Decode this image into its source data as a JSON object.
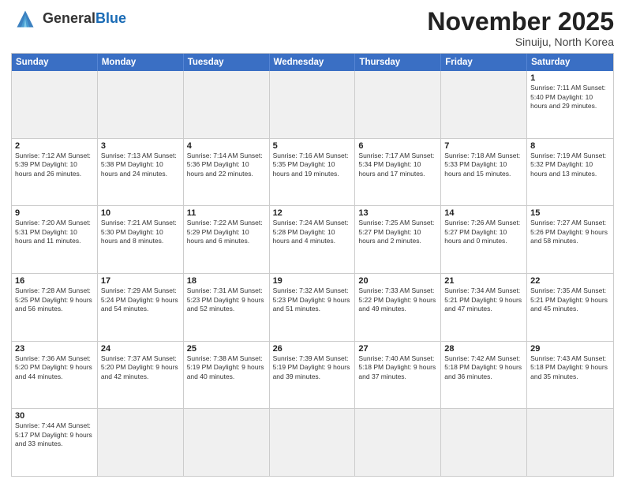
{
  "header": {
    "logo_general": "General",
    "logo_blue": "Blue",
    "month_title": "November 2025",
    "location": "Sinuiju, North Korea"
  },
  "days_of_week": [
    "Sunday",
    "Monday",
    "Tuesday",
    "Wednesday",
    "Thursday",
    "Friday",
    "Saturday"
  ],
  "weeks": [
    [
      {
        "day": "",
        "info": "",
        "empty": true
      },
      {
        "day": "",
        "info": "",
        "empty": true
      },
      {
        "day": "",
        "info": "",
        "empty": true
      },
      {
        "day": "",
        "info": "",
        "empty": true
      },
      {
        "day": "",
        "info": "",
        "empty": true
      },
      {
        "day": "",
        "info": "",
        "empty": true
      },
      {
        "day": "1",
        "info": "Sunrise: 7:11 AM\nSunset: 5:40 PM\nDaylight: 10 hours and 29 minutes.",
        "empty": false
      }
    ],
    [
      {
        "day": "2",
        "info": "Sunrise: 7:12 AM\nSunset: 5:39 PM\nDaylight: 10 hours and 26 minutes.",
        "empty": false
      },
      {
        "day": "3",
        "info": "Sunrise: 7:13 AM\nSunset: 5:38 PM\nDaylight: 10 hours and 24 minutes.",
        "empty": false
      },
      {
        "day": "4",
        "info": "Sunrise: 7:14 AM\nSunset: 5:36 PM\nDaylight: 10 hours and 22 minutes.",
        "empty": false
      },
      {
        "day": "5",
        "info": "Sunrise: 7:16 AM\nSunset: 5:35 PM\nDaylight: 10 hours and 19 minutes.",
        "empty": false
      },
      {
        "day": "6",
        "info": "Sunrise: 7:17 AM\nSunset: 5:34 PM\nDaylight: 10 hours and 17 minutes.",
        "empty": false
      },
      {
        "day": "7",
        "info": "Sunrise: 7:18 AM\nSunset: 5:33 PM\nDaylight: 10 hours and 15 minutes.",
        "empty": false
      },
      {
        "day": "8",
        "info": "Sunrise: 7:19 AM\nSunset: 5:32 PM\nDaylight: 10 hours and 13 minutes.",
        "empty": false
      }
    ],
    [
      {
        "day": "9",
        "info": "Sunrise: 7:20 AM\nSunset: 5:31 PM\nDaylight: 10 hours and 11 minutes.",
        "empty": false
      },
      {
        "day": "10",
        "info": "Sunrise: 7:21 AM\nSunset: 5:30 PM\nDaylight: 10 hours and 8 minutes.",
        "empty": false
      },
      {
        "day": "11",
        "info": "Sunrise: 7:22 AM\nSunset: 5:29 PM\nDaylight: 10 hours and 6 minutes.",
        "empty": false
      },
      {
        "day": "12",
        "info": "Sunrise: 7:24 AM\nSunset: 5:28 PM\nDaylight: 10 hours and 4 minutes.",
        "empty": false
      },
      {
        "day": "13",
        "info": "Sunrise: 7:25 AM\nSunset: 5:27 PM\nDaylight: 10 hours and 2 minutes.",
        "empty": false
      },
      {
        "day": "14",
        "info": "Sunrise: 7:26 AM\nSunset: 5:27 PM\nDaylight: 10 hours and 0 minutes.",
        "empty": false
      },
      {
        "day": "15",
        "info": "Sunrise: 7:27 AM\nSunset: 5:26 PM\nDaylight: 9 hours and 58 minutes.",
        "empty": false
      }
    ],
    [
      {
        "day": "16",
        "info": "Sunrise: 7:28 AM\nSunset: 5:25 PM\nDaylight: 9 hours and 56 minutes.",
        "empty": false
      },
      {
        "day": "17",
        "info": "Sunrise: 7:29 AM\nSunset: 5:24 PM\nDaylight: 9 hours and 54 minutes.",
        "empty": false
      },
      {
        "day": "18",
        "info": "Sunrise: 7:31 AM\nSunset: 5:23 PM\nDaylight: 9 hours and 52 minutes.",
        "empty": false
      },
      {
        "day": "19",
        "info": "Sunrise: 7:32 AM\nSunset: 5:23 PM\nDaylight: 9 hours and 51 minutes.",
        "empty": false
      },
      {
        "day": "20",
        "info": "Sunrise: 7:33 AM\nSunset: 5:22 PM\nDaylight: 9 hours and 49 minutes.",
        "empty": false
      },
      {
        "day": "21",
        "info": "Sunrise: 7:34 AM\nSunset: 5:21 PM\nDaylight: 9 hours and 47 minutes.",
        "empty": false
      },
      {
        "day": "22",
        "info": "Sunrise: 7:35 AM\nSunset: 5:21 PM\nDaylight: 9 hours and 45 minutes.",
        "empty": false
      }
    ],
    [
      {
        "day": "23",
        "info": "Sunrise: 7:36 AM\nSunset: 5:20 PM\nDaylight: 9 hours and 44 minutes.",
        "empty": false
      },
      {
        "day": "24",
        "info": "Sunrise: 7:37 AM\nSunset: 5:20 PM\nDaylight: 9 hours and 42 minutes.",
        "empty": false
      },
      {
        "day": "25",
        "info": "Sunrise: 7:38 AM\nSunset: 5:19 PM\nDaylight: 9 hours and 40 minutes.",
        "empty": false
      },
      {
        "day": "26",
        "info": "Sunrise: 7:39 AM\nSunset: 5:19 PM\nDaylight: 9 hours and 39 minutes.",
        "empty": false
      },
      {
        "day": "27",
        "info": "Sunrise: 7:40 AM\nSunset: 5:18 PM\nDaylight: 9 hours and 37 minutes.",
        "empty": false
      },
      {
        "day": "28",
        "info": "Sunrise: 7:42 AM\nSunset: 5:18 PM\nDaylight: 9 hours and 36 minutes.",
        "empty": false
      },
      {
        "day": "29",
        "info": "Sunrise: 7:43 AM\nSunset: 5:18 PM\nDaylight: 9 hours and 35 minutes.",
        "empty": false
      }
    ],
    [
      {
        "day": "30",
        "info": "Sunrise: 7:44 AM\nSunset: 5:17 PM\nDaylight: 9 hours and 33 minutes.",
        "empty": false
      },
      {
        "day": "",
        "info": "",
        "empty": true
      },
      {
        "day": "",
        "info": "",
        "empty": true
      },
      {
        "day": "",
        "info": "",
        "empty": true
      },
      {
        "day": "",
        "info": "",
        "empty": true
      },
      {
        "day": "",
        "info": "",
        "empty": true
      },
      {
        "day": "",
        "info": "",
        "empty": true
      }
    ]
  ]
}
